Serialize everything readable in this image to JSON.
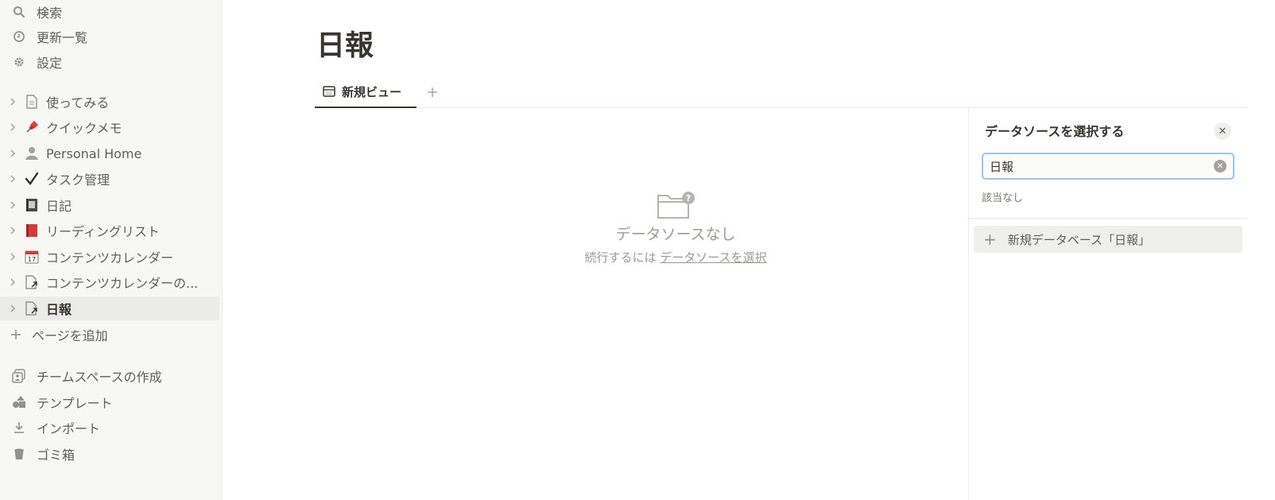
{
  "sidebar": {
    "top": [
      {
        "label": "検索",
        "icon": "search-icon"
      },
      {
        "label": "更新一覧",
        "icon": "clock-icon"
      },
      {
        "label": "設定",
        "icon": "gear-icon"
      }
    ],
    "pages": [
      {
        "label": "使ってみる",
        "icon": "document-icon"
      },
      {
        "label": "クイックメモ",
        "icon": "pushpin-icon"
      },
      {
        "label": "Personal Home",
        "icon": "person-icon"
      },
      {
        "label": "タスク管理",
        "icon": "checkmark-icon"
      },
      {
        "label": "日記",
        "icon": "notebook-icon"
      },
      {
        "label": "リーディングリスト",
        "icon": "red-book-icon"
      },
      {
        "label": "コンテンツカレンダー",
        "icon": "calendar-icon"
      },
      {
        "label": "コンテンツカレンダーの...",
        "icon": "linked-document-icon"
      },
      {
        "label": "日報",
        "icon": "linked-document-icon",
        "active": true
      }
    ],
    "add_page": "ページを追加",
    "bottom": [
      {
        "label": "チームスペースの作成",
        "icon": "teamspace-icon"
      },
      {
        "label": "テンプレート",
        "icon": "shapes-icon"
      },
      {
        "label": "インポート",
        "icon": "download-icon"
      },
      {
        "label": "ゴミ箱",
        "icon": "trash-icon"
      }
    ]
  },
  "page": {
    "title": "日報",
    "tab_label": "新規ビュー",
    "empty_title": "データソースなし",
    "empty_prefix": "続行するには",
    "empty_link": "データソースを選択"
  },
  "panel": {
    "title": "データソースを選択する",
    "search_value": "日報",
    "no_results": "該当なし",
    "new_db_label": "新規データベース「日報」"
  }
}
